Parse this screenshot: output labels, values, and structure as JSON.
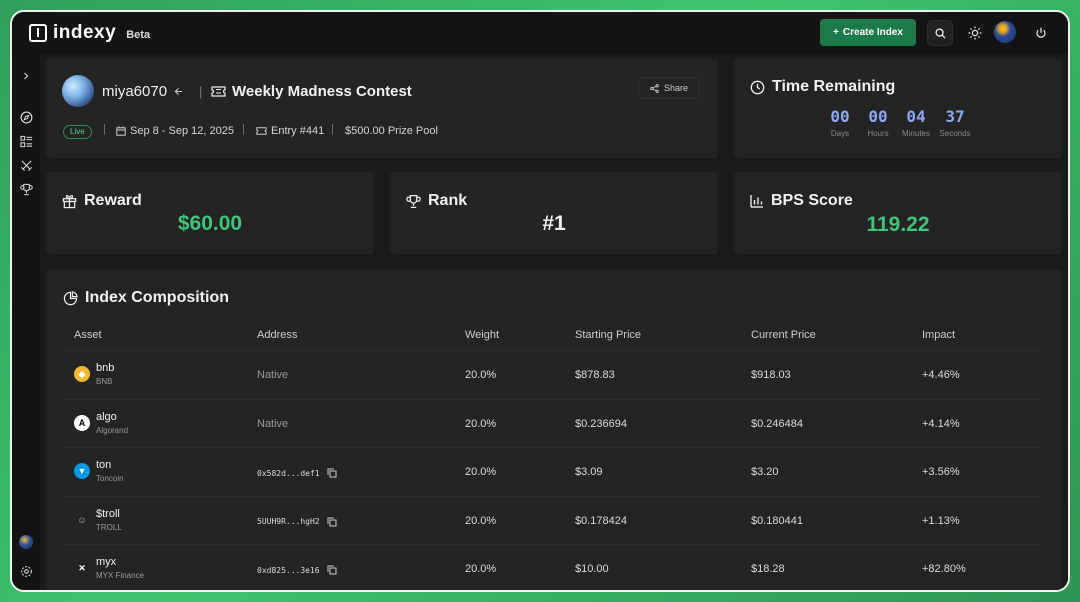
{
  "app": {
    "logo_text": "indexy",
    "badge": "Beta"
  },
  "header": {
    "create_label": "Create Index"
  },
  "contest": {
    "username": "miya6070",
    "name": "Weekly Madness Contest",
    "share_label": "Share",
    "status": "Live",
    "dates": "Sep 8 - Sep 12, 2025",
    "entry": "Entry #441",
    "prize_pool": "$500.00 Prize Pool"
  },
  "timer": {
    "title": "Time Remaining",
    "days": "00",
    "hours": "00",
    "minutes": "04",
    "seconds": "37",
    "days_label": "Days",
    "hours_label": "Hours",
    "minutes_label": "Minutes",
    "seconds_label": "Seconds"
  },
  "stats": {
    "reward_title": "Reward",
    "reward_value": "$60.00",
    "rank_title": "Rank",
    "rank_value": "#1",
    "bps_title": "BPS Score",
    "bps_value": "119.22"
  },
  "composition": {
    "title": "Index Composition",
    "columns": [
      "Asset",
      "Address",
      "Weight",
      "Starting Price",
      "Current Price",
      "Impact"
    ],
    "rows": [
      {
        "symbol": "bnb",
        "name": "BNB",
        "address": "Native",
        "weight": "20.0%",
        "start": "$878.83",
        "current": "$918.03",
        "impact": "+4.46%"
      },
      {
        "symbol": "algo",
        "name": "Algorand",
        "address": "Native",
        "weight": "20.0%",
        "start": "$0.236694",
        "current": "$0.246484",
        "impact": "+4.14%"
      },
      {
        "symbol": "ton",
        "name": "Toncoin",
        "address": "0x582d...def1",
        "weight": "20.0%",
        "start": "$3.09",
        "current": "$3.20",
        "impact": "+3.56%"
      },
      {
        "symbol": "$troll",
        "name": "TROLL",
        "address": "5UUH9R...hgH2",
        "weight": "20.0%",
        "start": "$0.178424",
        "current": "$0.180441",
        "impact": "+1.13%"
      },
      {
        "symbol": "myx",
        "name": "MYX Finance",
        "address": "0xd825...3e16",
        "weight": "20.0%",
        "start": "$10.00",
        "current": "$18.28",
        "impact": "+82.80%"
      }
    ]
  },
  "colors": {
    "accent_green": "#3fc47a",
    "timer_blue": "#8ea7f5",
    "button_green": "#1f7a4a"
  }
}
